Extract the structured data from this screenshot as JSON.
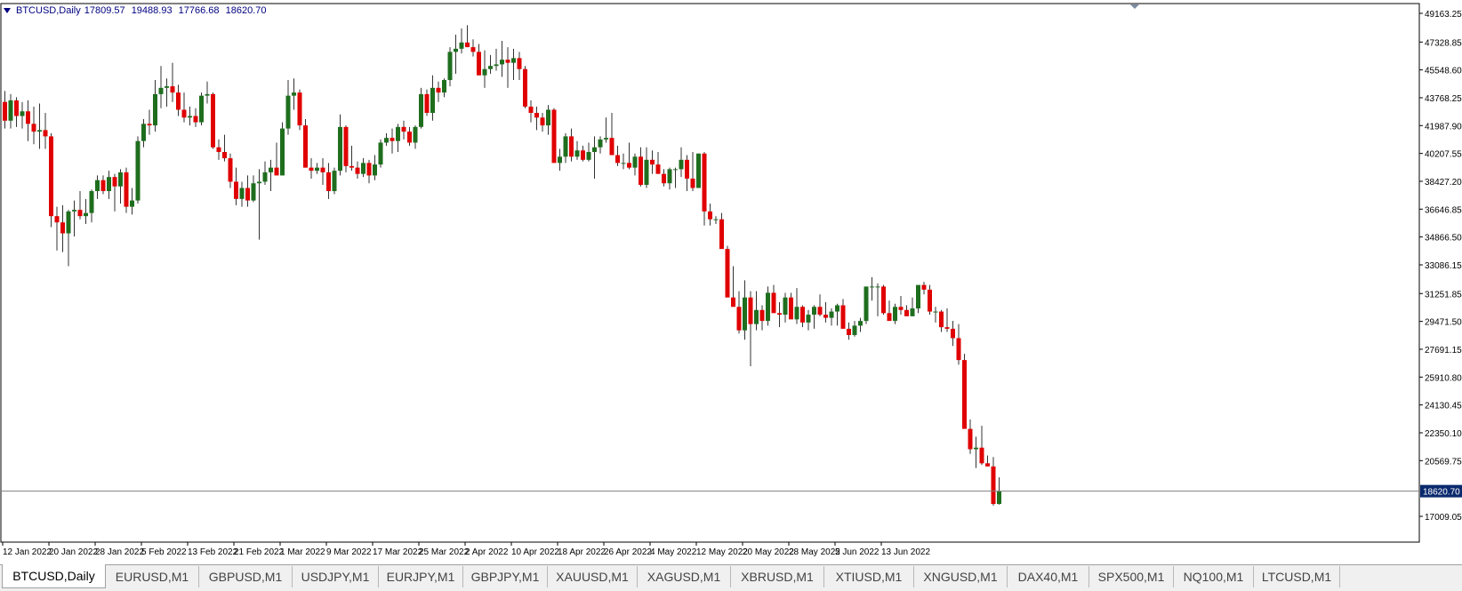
{
  "symbol_info": {
    "label": "BTCUSD,Daily",
    "open": "17809.57",
    "high": "19488.93",
    "low": "17766.68",
    "close": "18620.70"
  },
  "chart_data": {
    "type": "candlestick",
    "price_axis_ticks": [
      "49163.25",
      "47328.85",
      "45548.60",
      "43768.25",
      "41987.90",
      "40207.55",
      "38427.20",
      "36646.85",
      "34866.50",
      "33086.15",
      "31251.85",
      "29471.50",
      "27691.15",
      "25910.80",
      "24130.45",
      "22350.10",
      "20569.75",
      "17009.05"
    ],
    "price_tick_values": [
      49163.25,
      47328.85,
      45548.6,
      43768.25,
      41987.9,
      40207.55,
      38427.2,
      36646.85,
      34866.5,
      33086.15,
      31251.85,
      29471.5,
      27691.15,
      25910.8,
      24130.45,
      22350.1,
      20569.75,
      17009.05
    ],
    "current_price_label": "18620.70",
    "current_price": 18620.7,
    "date_axis_ticks": [
      "12 Jan 2022",
      "20 Jan 2022",
      "28 Jan 2022",
      "5 Feb 2022",
      "13 Feb 2022",
      "21 Feb 2022",
      "1 Mar 2022",
      "9 Mar 2022",
      "17 Mar 2022",
      "25 Mar 2022",
      "2 Apr 2022",
      "10 Apr 2022",
      "18 Apr 2022",
      "26 Apr 2022",
      "4 May 2022",
      "12 May 2022",
      "20 May 2022",
      "28 May 2022",
      "5 Jun 2022",
      "13 Jun 2022"
    ],
    "date_tick_index": [
      0,
      8,
      16,
      24,
      32,
      40,
      48,
      56,
      64,
      72,
      80,
      88,
      96,
      104,
      112,
      120,
      128,
      136,
      144,
      152
    ],
    "colors": {
      "bull": "#1e6e1e",
      "bear": "#e00000",
      "wick": "#333333",
      "grid": "#000000",
      "price_line": "#808080",
      "label_bg": "#0a2a6e"
    },
    "ohlc": [
      [
        43500,
        44200,
        41800,
        42300
      ],
      [
        42300,
        44000,
        41800,
        43600
      ],
      [
        43600,
        43800,
        41900,
        42600
      ],
      [
        42600,
        43500,
        41800,
        42900
      ],
      [
        42900,
        43600,
        41000,
        42100
      ],
      [
        42100,
        43200,
        40800,
        41600
      ],
      [
        41600,
        43400,
        40500,
        41700
      ],
      [
        41700,
        42800,
        40500,
        41300
      ],
      [
        41300,
        41500,
        35500,
        36200
      ],
      [
        36200,
        36800,
        34000,
        35800
      ],
      [
        35800,
        36900,
        33900,
        35100
      ],
      [
        35100,
        36600,
        33000,
        36500
      ],
      [
        36500,
        37200,
        34900,
        36600
      ],
      [
        36600,
        37800,
        36000,
        36200
      ],
      [
        36200,
        37300,
        35700,
        36400
      ],
      [
        36400,
        37900,
        35800,
        37800
      ],
      [
        37800,
        38800,
        37300,
        38500
      ],
      [
        38500,
        38800,
        37600,
        37800
      ],
      [
        37800,
        39100,
        37300,
        38700
      ],
      [
        38700,
        38900,
        36500,
        38100
      ],
      [
        38100,
        39200,
        37000,
        39000
      ],
      [
        39000,
        39300,
        36400,
        36800
      ],
      [
        36800,
        38000,
        36300,
        37200
      ],
      [
        37200,
        41300,
        37000,
        41000
      ],
      [
        41000,
        42400,
        40600,
        42100
      ],
      [
        42100,
        43000,
        41400,
        42000
      ],
      [
        42000,
        44900,
        41600,
        44000
      ],
      [
        44000,
        45800,
        43100,
        44400
      ],
      [
        44400,
        45000,
        43200,
        44500
      ],
      [
        44500,
        46000,
        43500,
        44100
      ],
      [
        44100,
        44600,
        42600,
        43000
      ],
      [
        43000,
        44100,
        42200,
        42500
      ],
      [
        42500,
        43200,
        42000,
        42600
      ],
      [
        42600,
        43100,
        41900,
        42200
      ],
      [
        42200,
        44100,
        42000,
        43900
      ],
      [
        43900,
        44800,
        43400,
        44000
      ],
      [
        44000,
        44100,
        40500,
        40600
      ],
      [
        40600,
        41100,
        39800,
        40300
      ],
      [
        40300,
        41400,
        39700,
        39900
      ],
      [
        39900,
        40200,
        38000,
        38400
      ],
      [
        38400,
        39300,
        36900,
        37300
      ],
      [
        37300,
        38400,
        36800,
        38000
      ],
      [
        38000,
        38800,
        36800,
        37200
      ],
      [
        37200,
        38800,
        37100,
        38300
      ],
      [
        38300,
        39200,
        34700,
        38400
      ],
      [
        38400,
        39700,
        38200,
        39000
      ],
      [
        39000,
        39800,
        37800,
        39300
      ],
      [
        39300,
        40900,
        39000,
        38800
      ],
      [
        38800,
        42200,
        38800,
        41800
      ],
      [
        41800,
        44900,
        41400,
        43900
      ],
      [
        43900,
        45000,
        43000,
        44100
      ],
      [
        44100,
        44300,
        41700,
        42000
      ],
      [
        42000,
        42400,
        39300,
        39300
      ],
      [
        39300,
        39900,
        38600,
        39100
      ],
      [
        39100,
        39600,
        38900,
        39300
      ],
      [
        39300,
        39900,
        38200,
        39000
      ],
      [
        39000,
        39600,
        37300,
        37800
      ],
      [
        37800,
        39300,
        37600,
        39100
      ],
      [
        39100,
        42700,
        38800,
        41900
      ],
      [
        41900,
        42000,
        39000,
        39400
      ],
      [
        39400,
        40700,
        39100,
        39300
      ],
      [
        39300,
        39700,
        38600,
        38900
      ],
      [
        38900,
        39900,
        38700,
        39600
      ],
      [
        39600,
        39800,
        38300,
        38800
      ],
      [
        38800,
        40100,
        38500,
        39500
      ],
      [
        39500,
        41100,
        39300,
        40900
      ],
      [
        40900,
        41500,
        40700,
        41200
      ],
      [
        41200,
        41800,
        40200,
        41000
      ],
      [
        41000,
        42100,
        40300,
        41900
      ],
      [
        41900,
        42300,
        41100,
        41600
      ],
      [
        41600,
        41900,
        40700,
        40900
      ],
      [
        40900,
        42000,
        40500,
        41900
      ],
      [
        41900,
        44400,
        41800,
        44000
      ],
      [
        44000,
        44300,
        42600,
        42800
      ],
      [
        42800,
        45200,
        42300,
        44400
      ],
      [
        44400,
        44800,
        43500,
        44100
      ],
      [
        44100,
        45000,
        43800,
        44900
      ],
      [
        44900,
        47000,
        44500,
        46700
      ],
      [
        46700,
        47800,
        45300,
        46900
      ],
      [
        46900,
        48200,
        46600,
        47300
      ],
      [
        47300,
        48400,
        47000,
        47000
      ],
      [
        47000,
        47500,
        46400,
        46700
      ],
      [
        46700,
        47200,
        45200,
        45200
      ],
      [
        45200,
        46800,
        44400,
        45600
      ],
      [
        45600,
        46500,
        45300,
        45800
      ],
      [
        45800,
        46900,
        45500,
        45900
      ],
      [
        45900,
        47400,
        45100,
        46200
      ],
      [
        46200,
        47000,
        44400,
        46000
      ],
      [
        46000,
        46900,
        44900,
        46300
      ],
      [
        46300,
        46700,
        44900,
        45600
      ],
      [
        45600,
        45800,
        43100,
        43200
      ],
      [
        43200,
        43600,
        42200,
        42800
      ],
      [
        42800,
        43200,
        41700,
        42500
      ],
      [
        42500,
        42800,
        41600,
        42000
      ],
      [
        42000,
        43300,
        41400,
        43000
      ],
      [
        43000,
        43100,
        39800,
        39600
      ],
      [
        39600,
        40500,
        39100,
        40000
      ],
      [
        40000,
        41500,
        39600,
        41300
      ],
      [
        41300,
        41800,
        39700,
        40000
      ],
      [
        40000,
        41000,
        39800,
        40400
      ],
      [
        40400,
        40700,
        39700,
        39800
      ],
      [
        39800,
        40900,
        39700,
        40300
      ],
      [
        40300,
        41300,
        38600,
        40600
      ],
      [
        40600,
        41300,
        40200,
        41100
      ],
      [
        41100,
        42500,
        40900,
        41200
      ]
    ],
    "tail_ohlc": [
      [
        41200,
        42800,
        40400,
        40100
      ],
      [
        40100,
        40700,
        39400,
        39600
      ],
      [
        39600,
        40200,
        39200,
        39600
      ],
      [
        39600,
        40900,
        39200,
        39300
      ],
      [
        39300,
        40200,
        38800,
        40000
      ],
      [
        40000,
        40600,
        38100,
        38200
      ],
      [
        38200,
        40600,
        38000,
        39800
      ],
      [
        39800,
        40400,
        38900,
        39500
      ],
      [
        39500,
        40300,
        38900,
        38900
      ],
      [
        38900,
        39200,
        38100,
        38300
      ],
      [
        38300,
        39300,
        37900,
        39200
      ],
      [
        39200,
        39300,
        38000,
        39200
      ],
      [
        39200,
        40600,
        38700,
        39800
      ],
      [
        39800,
        40100,
        37800,
        38600
      ],
      [
        38600,
        40300,
        37800,
        38000
      ],
      [
        38000,
        40200,
        38000,
        40200
      ],
      [
        40200,
        40300,
        35600,
        36500
      ],
      [
        36500,
        37000,
        35600,
        36000
      ],
      [
        36000,
        36200,
        35700,
        36000
      ],
      [
        36000,
        36400,
        34600,
        34100
      ],
      [
        34100,
        34300,
        31500,
        31000
      ],
      [
        31000,
        33000,
        30700,
        30400
      ],
      [
        30400,
        31400,
        28700,
        28900
      ],
      [
        28900,
        32100,
        28300,
        31000
      ],
      [
        31000,
        31400,
        26600,
        29300
      ],
      [
        29300,
        31400,
        28900,
        30200
      ],
      [
        30200,
        30500,
        28900,
        29500
      ],
      [
        29500,
        31700,
        29200,
        31300
      ],
      [
        31300,
        31800,
        30300,
        30000
      ],
      [
        30000,
        30700,
        29100,
        29900
      ],
      [
        29900,
        31300,
        29400,
        31000
      ],
      [
        31000,
        31300,
        29700,
        29600
      ],
      [
        29600,
        31600,
        29300,
        30400
      ],
      [
        30400,
        30500,
        29100,
        29400
      ],
      [
        29400,
        30200,
        28900,
        29900
      ],
      [
        29900,
        30500,
        29000,
        30400
      ],
      [
        30400,
        31200,
        29800,
        29900
      ],
      [
        29900,
        30700,
        29400,
        29700
      ],
      [
        29700,
        30300,
        29200,
        30100
      ],
      [
        30100,
        30600,
        29200,
        30500
      ],
      [
        30500,
        30900,
        29400,
        29000
      ],
      [
        29000,
        29400,
        28300,
        28600
      ],
      [
        28600,
        29500,
        28500,
        29200
      ],
      [
        29200,
        29700,
        28800,
        29500
      ],
      [
        29500,
        31100,
        29300,
        31700
      ],
      [
        31700,
        32300,
        30800,
        31700
      ],
      [
        31700,
        31900,
        29800,
        31700
      ],
      [
        31700,
        31800,
        29900,
        30000
      ],
      [
        30000,
        30800,
        29700,
        29500
      ],
      [
        29500,
        30600,
        29300,
        30400
      ],
      [
        30400,
        31100,
        29900,
        30200
      ],
      [
        30200,
        30500,
        29900,
        29800
      ],
      [
        29800,
        31000,
        29800,
        30300
      ],
      [
        30300,
        31700,
        30000,
        31800
      ],
      [
        31800,
        32000,
        31200,
        31500
      ],
      [
        31500,
        31800,
        29900,
        30100
      ],
      [
        30100,
        30400,
        29400,
        30100
      ],
      [
        30100,
        30200,
        28800,
        29100
      ],
      [
        29100,
        30300,
        28800,
        29000
      ],
      [
        29000,
        29500,
        27900,
        28400
      ],
      [
        28400,
        29300,
        26700,
        27000
      ],
      [
        27000,
        27400,
        22700,
        22600
      ],
      [
        22600,
        23200,
        21000,
        21300
      ],
      [
        21300,
        22100,
        20100,
        21400
      ],
      [
        21400,
        22800,
        20300,
        20400
      ],
      [
        20400,
        20900,
        20200,
        20200
      ],
      [
        20200,
        20800,
        17700,
        17800
      ],
      [
        17800,
        19500,
        17760,
        18620
      ]
    ]
  },
  "tabs": [
    {
      "label": "BTCUSD,Daily",
      "active": true
    },
    {
      "label": "EURUSD,M1"
    },
    {
      "label": "GBPUSD,M1"
    },
    {
      "label": "USDJPY,M1"
    },
    {
      "label": "EURJPY,M1"
    },
    {
      "label": "GBPJPY,M1"
    },
    {
      "label": "XAUUSD,M1"
    },
    {
      "label": "XAGUSD,M1"
    },
    {
      "label": "XBRUSD,M1"
    },
    {
      "label": "XTIUSD,M1"
    },
    {
      "label": "XNGUSD,M1"
    },
    {
      "label": "DAX40,M1"
    },
    {
      "label": "SPX500,M1"
    },
    {
      "label": "NQ100,M1"
    },
    {
      "label": "LTCUSD,M1"
    }
  ]
}
